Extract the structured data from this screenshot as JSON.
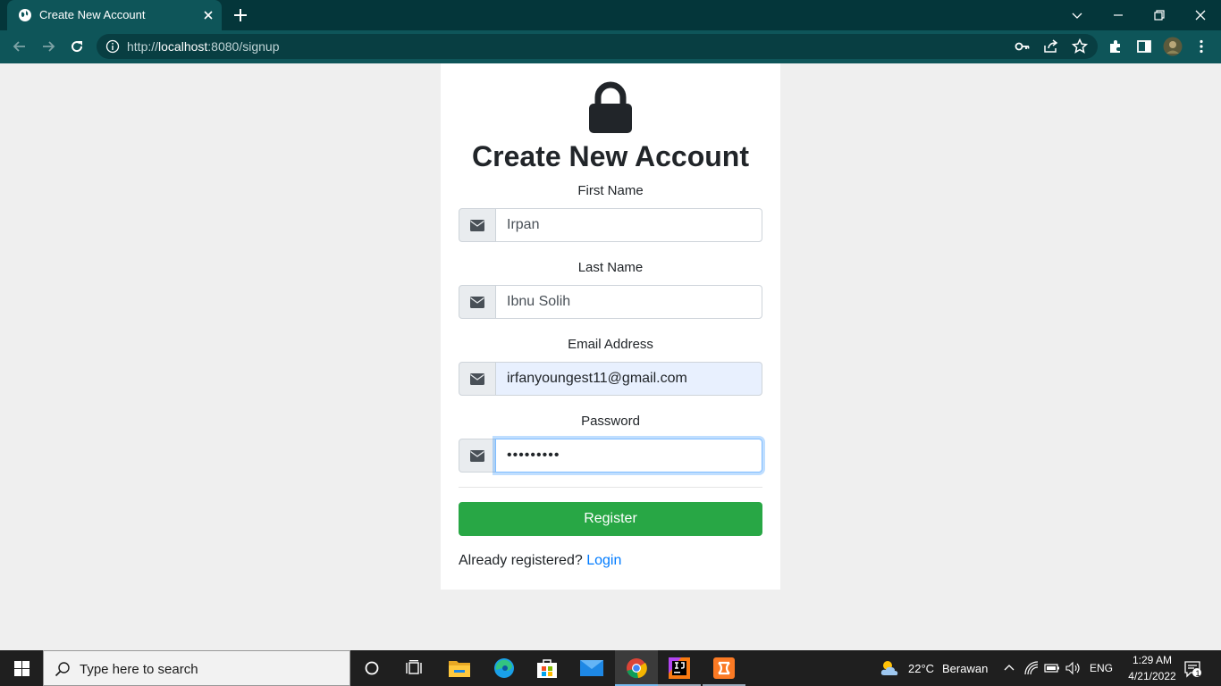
{
  "browser": {
    "tab_title": "Create New Account",
    "url_prefix": "http://",
    "url_host": "localhost",
    "url_rest": ":8080/signup"
  },
  "page": {
    "heading": "Create New Account",
    "first_name": {
      "label": "First Name",
      "value": "Irpan"
    },
    "last_name": {
      "label": "Last Name",
      "value": "Ibnu Solih"
    },
    "email": {
      "label": "Email Address",
      "value": "irfanyoungest11@gmail.com"
    },
    "password": {
      "label": "Password",
      "value": "•••••••••"
    },
    "register_label": "Register",
    "already_text": "Already registered?",
    "login_label": "Login",
    "accent_color": "#28a745",
    "link_color": "#007bff"
  },
  "taskbar": {
    "search_placeholder": "Type here to search",
    "weather_temp": "22°C",
    "weather_desc": "Berawan",
    "language": "ENG",
    "time": "1:29 AM",
    "date": "4/21/2022",
    "notification_count": "1"
  },
  "icons": [
    "globe-icon",
    "close-icon",
    "plus-icon",
    "chevron-down-icon",
    "minimize-icon",
    "restore-icon",
    "back-arrow-icon",
    "forward-arrow-icon",
    "reload-icon",
    "info-icon",
    "key-icon",
    "share-icon",
    "star-icon",
    "puzzle-icon",
    "sidepanel-icon",
    "avatar",
    "kebab-menu-icon",
    "lock-icon",
    "envelope-icon",
    "windows-logo-icon",
    "search-icon",
    "cortana-icon",
    "task-view-icon",
    "file-explorer-icon",
    "edge-icon",
    "store-icon",
    "mail-icon",
    "chrome-icon",
    "intellij-icon",
    "xampp-icon",
    "cloud-icon",
    "chevron-up-icon",
    "wifi-icon",
    "battery-icon",
    "volume-icon",
    "notification-icon"
  ]
}
